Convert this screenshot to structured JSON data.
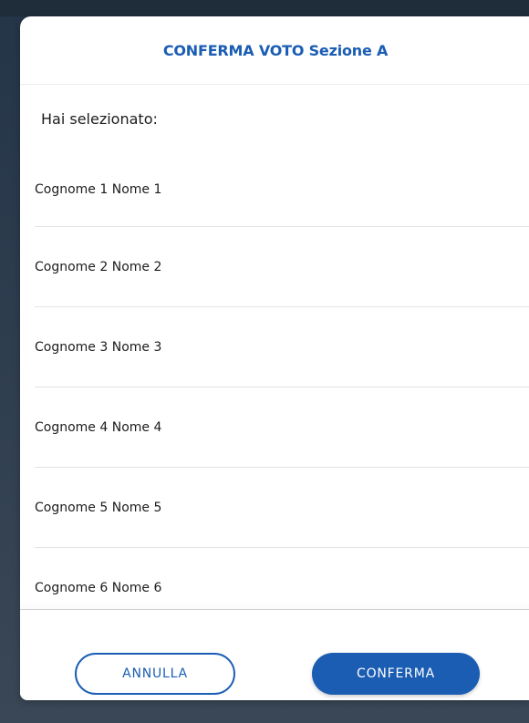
{
  "modal": {
    "title": "CONFERMA VOTO Sezione A",
    "intro": "Hai selezionato:",
    "candidates": [
      "Cognome 1 Nome 1",
      "Cognome 2 Nome 2",
      "Cognome 3 Nome 3",
      "Cognome 4 Nome 4",
      "Cognome 5 Nome 5",
      "Cognome 6 Nome 6"
    ],
    "buttons": {
      "cancel": "ANNULLA",
      "confirm": "CONFERMA"
    }
  },
  "colors": {
    "accent": "#1a5db3",
    "backdrop": "#2b3a4a"
  }
}
